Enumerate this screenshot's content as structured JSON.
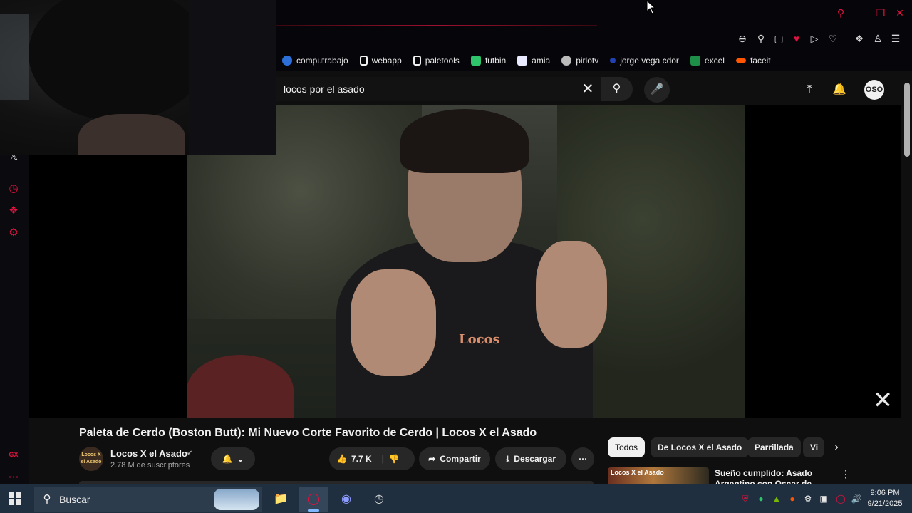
{
  "browser": {
    "bookmarks": [
      {
        "label": "computrabajo",
        "color": "#2d6fd8"
      },
      {
        "label": "webapp",
        "color": "#f1f1f1"
      },
      {
        "label": "paletools",
        "color": "#f1f1f1"
      },
      {
        "label": "futbin",
        "color": "#2ec46b"
      },
      {
        "label": "amia",
        "color": "#e9e9ff"
      },
      {
        "label": "pirlotv",
        "color": "#bbbbbb"
      },
      {
        "label": "jorge vega cdor",
        "color": "#2240b0"
      },
      {
        "label": "excel",
        "color": "#1d8f48"
      },
      {
        "label": "faceit",
        "color": "#ff5500"
      }
    ],
    "accent": "#e0123f"
  },
  "youtube": {
    "search": {
      "value": "locos por el asado"
    },
    "avatar": "OSO",
    "video_title": "Paleta de Cerdo (Boston Butt): Mi Nuevo Corte Favorito de Cerdo | Locos X el Asado",
    "video_frame_brand": "Locos",
    "channel": {
      "name": "Locos X el Asado",
      "subscribers": "2.78 M de suscriptores",
      "avatar_text": "Locos X el Asado"
    },
    "actions": {
      "likes": "7.7 K",
      "share": "Compartir",
      "download": "Descargar"
    },
    "chips": [
      "Todos",
      "De Locos X el Asado",
      "Parrillada",
      "Vi"
    ],
    "recommendation": {
      "title": "Sueño cumplido: Asado Argentino con Oscar de",
      "thumb_text": "Locos X el Asado"
    }
  },
  "taskbar": {
    "search_placeholder": "Buscar",
    "time": "9:06 PM",
    "date": "9/21/2025"
  }
}
